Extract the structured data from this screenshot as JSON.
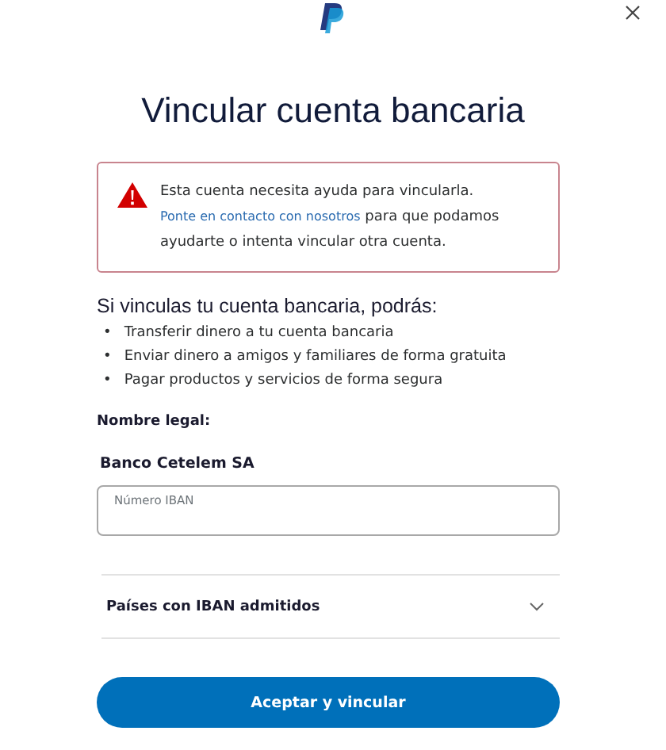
{
  "title": "Vincular cuenta bancaria",
  "alert": {
    "text_before": "Esta cuenta necesita ayuda para vincularla.",
    "link": "Ponte en contacto con nosotros",
    "text_after": "para que podamos ayudarte o intenta vincular otra cuenta."
  },
  "benefits": {
    "heading": "Si vinculas tu cuenta bancaria, podrás:",
    "marker": "•",
    "items": [
      "Transferir dinero a tu cuenta bancaria",
      "Enviar dinero a amigos y familiares de forma gratuita",
      "Pagar productos y servicios de forma segura"
    ]
  },
  "legal_name": {
    "label": "Nombre legal:",
    "value": "Banco Cetelem SA"
  },
  "iban_field": {
    "placeholder": "Número IBAN"
  },
  "accordion": {
    "label": "Países con IBAN admitidos",
    "expanded": false
  },
  "button": "Aceptar y vincular"
}
